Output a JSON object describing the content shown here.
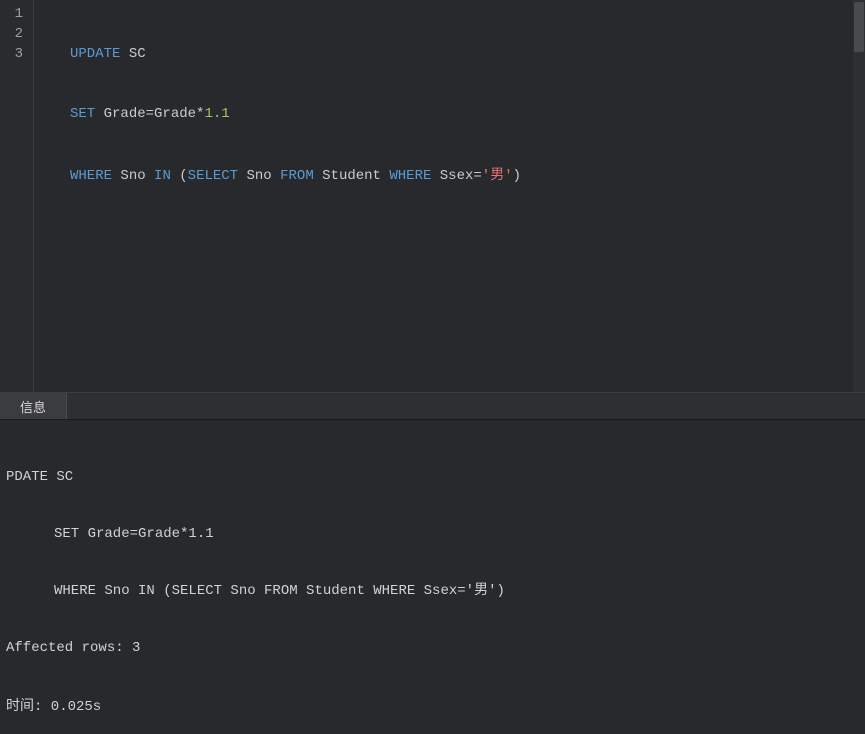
{
  "editor": {
    "gutter": [
      "1",
      "2",
      "3"
    ],
    "lines": {
      "l1": {
        "kw_update": "UPDATE",
        "tbl": "SC"
      },
      "l2": {
        "kw_set": "SET",
        "expr_lhs": "Grade=Grade*",
        "num": "1.1"
      },
      "l3": {
        "kw_where": "WHERE",
        "col": "Sno",
        "kw_in": "IN",
        "lp": "(",
        "kw_select": "SELECT",
        "sel_col": "Sno",
        "kw_from": "FROM",
        "from_tbl": "Student",
        "kw_where2": "WHERE",
        "cond_lhs": "Ssex=",
        "sq1": "'",
        "str_val": "男",
        "sq2": "'",
        "rp": ")"
      }
    }
  },
  "tab": {
    "label": "信息"
  },
  "output": {
    "l1": "PDATE SC",
    "l2": "SET Grade=Grade*1.1",
    "l3": "WHERE Sno IN (SELECT Sno FROM Student WHERE Ssex='男')",
    "l4": "Affected rows: 3",
    "l5_prefix": "时间",
    "l5_rest": ": 0.025s"
  }
}
